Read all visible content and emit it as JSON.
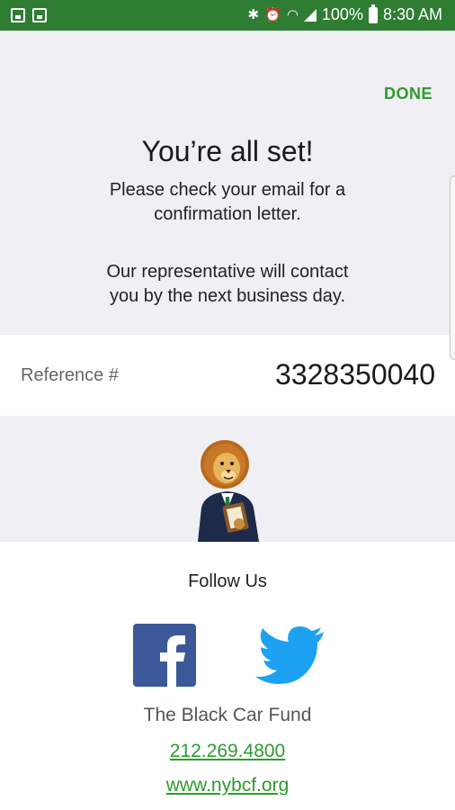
{
  "status_bar": {
    "battery_text": "100%",
    "time": "8:30 AM",
    "bg_color": "#2e7d32"
  },
  "header": {
    "done_label": "DONE",
    "accent_color": "#2e9b2e"
  },
  "confirmation": {
    "title": "You’re all set!",
    "message_1_line1": "Please check your email for a",
    "message_1_line2": "confirmation letter.",
    "message_2_line1": "Our representative will contact",
    "message_2_line2": "you by the next business day."
  },
  "reference": {
    "label": "Reference #",
    "value": "3328350040"
  },
  "footer": {
    "follow_label": "Follow Us",
    "social": [
      {
        "name": "facebook-icon"
      },
      {
        "name": "twitter-icon"
      }
    ],
    "company_name": "The Black Car Fund",
    "phone": "212.269.4800",
    "website": "www.nybcf.org"
  }
}
